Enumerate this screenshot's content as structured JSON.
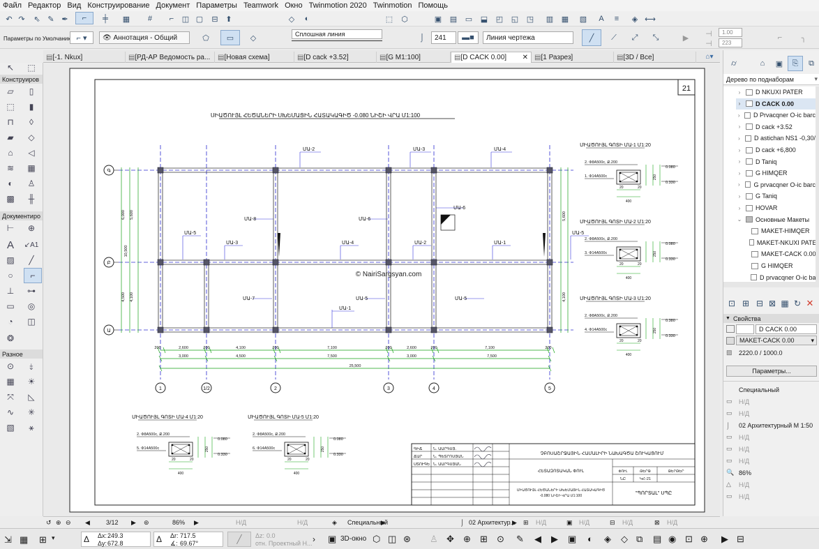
{
  "menu": [
    "Файл",
    "Редактор",
    "Вид",
    "Конструирование",
    "Документ",
    "Параметры",
    "Teamwork",
    "Окно",
    "Twinmotion 2020",
    "Twinmotion",
    "Помощь"
  ],
  "infobox": {
    "default_params": "Параметры по Умолчанию",
    "annotation": "Аннотация - Общий",
    "line_type": "Сплошная линия",
    "pen_number": "241",
    "line_category": "Линия чертежа",
    "num1": "1.00",
    "num2": "223"
  },
  "tabs": [
    {
      "label": "[-1. Nkux]",
      "active": false
    },
    {
      "label": "[РД-АР Ведомость ра...",
      "active": false
    },
    {
      "label": "[Новая схема]",
      "active": false
    },
    {
      "label": "[D cack +3.52]",
      "active": false
    },
    {
      "label": "[G M1:100]",
      "active": false
    },
    {
      "label": "[D CACK 0.00]",
      "active": true
    },
    {
      "label": "[1 Разрез]",
      "active": false
    },
    {
      "label": "[3D / Все]",
      "active": false
    }
  ],
  "toolbox": {
    "sections": [
      "Конструиров",
      "Документиро",
      "Разное"
    ],
    "tool_icon_a1": "A1"
  },
  "navigator": {
    "header": "Дерево по поднаборам",
    "items": [
      {
        "label": "D NKUXI PATER",
        "selected": false,
        "expandable": true
      },
      {
        "label": "D CACK 0.00",
        "selected": true,
        "expandable": true
      },
      {
        "label": "D Prvacqner O-ic barc",
        "selected": false,
        "expandable": true
      },
      {
        "label": "D cack +3.52",
        "selected": false,
        "expandable": true
      },
      {
        "label": "D astichan NS1 -0,30/",
        "selected": false,
        "expandable": true
      },
      {
        "label": "D cack +6,800",
        "selected": false,
        "expandable": true
      },
      {
        "label": "D Taniq",
        "selected": false,
        "expandable": true
      },
      {
        "label": "G HIMQER",
        "selected": false,
        "expandable": true
      },
      {
        "label": "G prvacqner O-ic barc",
        "selected": false,
        "expandable": true
      },
      {
        "label": "G Taniq",
        "selected": false,
        "expandable": true
      },
      {
        "label": "HOVAR",
        "selected": false,
        "expandable": true
      },
      {
        "label": "Основные Макеты",
        "selected": false,
        "expandable": true
      },
      {
        "label": "MAKET-HIMQER",
        "selected": false,
        "expandable": false
      },
      {
        "label": "MAKET-NKUXI PATER",
        "selected": false,
        "expandable": false
      },
      {
        "label": "MAKET-CACK 0.00",
        "selected": false,
        "expandable": false
      },
      {
        "label": "G HIMQER",
        "selected": false,
        "expandable": false
      },
      {
        "label": "D prvacqner O-ic barc",
        "selected": false,
        "expandable": false
      }
    ]
  },
  "properties": {
    "header": "Свойства",
    "name": "D CACK 0.00",
    "layout": "MAKET-CACK 0.00",
    "size": "2220.0 / 1000.0",
    "params_button": "Параметры...",
    "special": "Специальный",
    "nd": "Н/Д",
    "scale": "02 Архитектурный М 1:50",
    "zoom": "86%"
  },
  "statusbar": {
    "page": "3/12",
    "zoom": "86%",
    "nd": "Н/Д",
    "special": "Специальный",
    "arch": "02 Архитектур..."
  },
  "bottombar": {
    "dx_label": "Δx:",
    "dx": "249.3",
    "dy_label": "Δy:",
    "dy": "672.8",
    "dr_label": "Δr:",
    "dr": "717.5",
    "da_label": "∡:",
    "da": "69.67°",
    "dz_label": "Δz:",
    "dz": "0.0",
    "project_label": "отн. Проектный Н...",
    "view3d": "3D-окно"
  },
  "drawing": {
    "sheet_number": "21",
    "main_title": "ՍԻԱԾՈՒՅԼ ՀԵԾԱՆԵՐԻ ՍԽԵՄԱՑԻՆ ՀԱՏԱԿԱԳԻԾ -0.080 ՆԻՇԻ ՎՐԱ Մ1:100",
    "watermark": "© NairiSargsyan.com",
    "axis_rows": [
      "Գ",
      "Բ",
      "Ա"
    ],
    "axis_cols": [
      "1",
      "1/2",
      "2",
      "3",
      "4",
      "5"
    ],
    "beam_labels_top": [
      "ՄԱ-2",
      "ՄԱ-3",
      "ՄԱ-4"
    ],
    "beam_labels_mid": [
      "ՄԱ-5",
      "ՄԱ-3",
      "ՄԱ-4",
      "ՄԱ-2",
      "ՄԱ-1",
      "ՄԱ-5"
    ],
    "beam_labels_bottom": [
      "ՄԱ-1"
    ],
    "beam_labels_vertical": [
      "ՄԱ-8",
      "ՄԱ-6",
      "ՄԱ-6",
      "ՄԱ-7",
      "ՄԱ-5",
      "ՄԱ-5"
    ],
    "dims_row1": [
      "200",
      "2,600",
      "200",
      "4,100",
      "200",
      "7,100",
      "200",
      "2,600",
      "200",
      "7,100",
      "200"
    ],
    "dims_row2": [
      "3,000",
      "4,500",
      "7,500",
      "3,000",
      "7,500"
    ],
    "dims_total": "25,500",
    "dims_left": [
      "6,000",
      "5,600",
      "10,500",
      "4,500",
      "4,100"
    ],
    "dims_right": [
      "5,600",
      "4,100"
    ],
    "sections": [
      {
        "title": "ՄԻԱԾՈՒՅԼ ԳՈՏԻ ՄԱ-1 Մ1:20",
        "top": "2. Φ8A500c, Ք.200",
        "bottom": "1. Φ14A500c",
        "dims": [
          "0.080",
          "0.330",
          "250"
        ],
        "widths": [
          "20",
          "400",
          "20"
        ]
      },
      {
        "title": "ՄԻԱԾՈՒՅԼ ԳՈՏԻ ՄԱ-2 Մ1:20",
        "top": "2. Φ8A500c, Ք.200",
        "bottom": "3. Φ14A500c",
        "dims": [
          "0.080",
          "0.330",
          "250"
        ],
        "widths": [
          "20",
          "400",
          "20"
        ]
      },
      {
        "title": "ՄԻԱԾՈՒՅԼ ԳՈՏԻ ՄԱ-3 Մ1:20",
        "top": "2. Φ8A500c, Ք.200",
        "bottom": "4. Φ14A500c",
        "dims": [
          "0.380",
          "0.330",
          "250"
        ],
        "widths": [
          "20",
          "400",
          "20"
        ]
      },
      {
        "title": "ՄԻԱԾՈՒՅԼ ԳՈՏԻ ՄԱ-4 Մ1:20",
        "top": "2. Φ8A500c, Ք.200",
        "bottom": "5. Φ14A500c",
        "dims": [
          "0.080",
          "0.330",
          "250"
        ],
        "widths": [
          "20",
          "400",
          "20"
        ]
      },
      {
        "title": "ՄԻԱԾՈՒՅԼ ԳՈՏԻ ՄԱ-5 Մ1:20",
        "top": "2. Φ8A500c, Ք.200",
        "bottom": "6. Φ14A500c",
        "dims": [
          "0.080",
          "0.330",
          "250"
        ],
        "widths": [
          "20",
          "400",
          "20"
        ]
      }
    ],
    "stamp": {
      "rows": [
        [
          "ԳԻՃ",
          "Ն. ԱԱՐԳՍՅ."
        ],
        [
          "ՃԱՐ",
          "Ն. ՊԵՏՐՈՍՅԱՆ"
        ],
        [
          "ՍՏՈՒԳԵ",
          "Ն. ԱԱՐԳՍՅԱՆ"
        ]
      ],
      "project": "ՉԲՈՍԱՇՐՋԱՅԻՆ ՀԱՄԱԼԻՐԻ ՆԱԽԱԳԾԱ ՇՈՒԿԱՑՈՒՄ",
      "stage_label": "ՀԵՏԱԶՈՏԱԿԱՆ ՓՈՒԼ",
      "col_headers": [
        "ՓՈՒԼ",
        "ԹԵՐԹ",
        "ԹԵՐԹԵՐ"
      ],
      "col_values": [
        "ՆԸ",
        "ԿՀ-21",
        ""
      ],
      "sheet_title": "ՄԻԱԾՈՒՅԼ ՀԵԾԱՆԵՐԻ ՍԽԵՄԱՑԻՆ ՀԱՏԱԿԱԳԻԾ -0.080 ՆԻՇԻ ՎՐԱ Մ1:100",
      "company": "\"ՊՈՐՏԱԼ\" ՍՊԸ"
    }
  },
  "colors": {
    "accent": "#3d6ea5",
    "grid_axis": "#2c2cd0",
    "dims": "#17a317",
    "column": "#556",
    "selected_tab_bg": "#ffffff",
    "close_x": "#d23b2b"
  }
}
